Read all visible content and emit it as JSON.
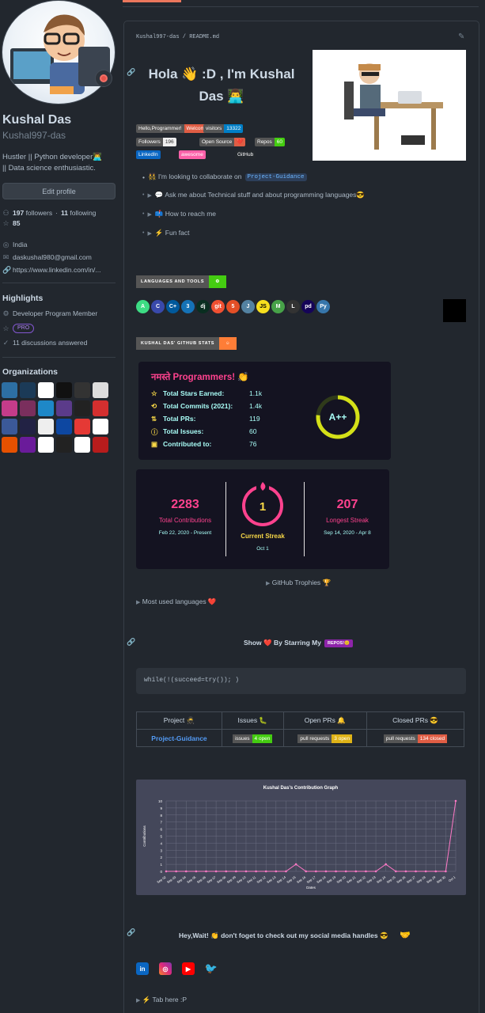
{
  "profile": {
    "name": "Kushal Das",
    "login": "Kushal997-das",
    "bio_line1": "Hustler || Python developer👨‍💻",
    "bio_line2": "|| Data science enthusiastic.",
    "edit_label": "Edit profile",
    "followers_count": "197",
    "followers_label": "followers",
    "following_count": "11",
    "following_label": "following",
    "stars": "85",
    "location": "India",
    "email": "daskushal980@gmail.com",
    "website": "https://www.linkedin.com/in/..."
  },
  "highlights": {
    "title": "Highlights",
    "program": "Developer Program Member",
    "pro": "PRO",
    "discussions": "11 discussions answered"
  },
  "organizations": {
    "title": "Organizations",
    "colors": [
      "#2d6fa3",
      "#1b3a57",
      "#ffffff",
      "#111111",
      "#333333",
      "#dddddd",
      "#c43c8a",
      "#7a2f5d",
      "#1e88c8",
      "#5b3b8a",
      "#222222",
      "#d32f2f",
      "#3b5998",
      "#222244",
      "#eeeeee",
      "#0d47a1",
      "#e53935",
      "#ffffff",
      "#e65100",
      "#6a1b9a",
      "#ffffff",
      "#222222",
      "#ffffff",
      "#b71c1c"
    ]
  },
  "readme": {
    "path": "Kushal997-das / README.md",
    "greeting_line1": "Hola 👋 :D , I'm Kushal",
    "greeting_line2": "Das 👨‍💻",
    "badges": [
      {
        "left": "Hello,Programmer!",
        "right": "Welcome<3",
        "color": "#e05d44"
      },
      {
        "left": "visitors",
        "right": "13322",
        "color": "#007ec6"
      },
      {
        "left": "Followers",
        "right": "196",
        "color": "#eeeeee"
      },
      {
        "left": "Open Source",
        "right": "❤️",
        "color": "#e05d44"
      },
      {
        "left": "Repos",
        "right": "60",
        "color": "#4c1"
      },
      {
        "left": "LinkedIn",
        "right": "",
        "color": "#0a66c2"
      },
      {
        "left": "awesome",
        "right": "",
        "color": "#fc60a8"
      },
      {
        "left": "GitHub",
        "right": "",
        "color": "#24292e"
      }
    ],
    "bullets": {
      "collab_prefix": "👯 I'm looking to collaborate on",
      "collab_project": "Project-Guidance",
      "ask": "💬 Ask me about Technical stuff and about programming languages😎",
      "reach": "📫 How to reach me",
      "fun": "⚡ Fun fact"
    },
    "languages_strip": "LANGUAGES AND TOOLS",
    "techs": [
      {
        "label": "A",
        "color": "#3ddc84"
      },
      {
        "label": "C",
        "color": "#3949ab"
      },
      {
        "label": "C+",
        "color": "#00599c"
      },
      {
        "label": "3",
        "color": "#1572b6"
      },
      {
        "label": "dj",
        "color": "#092e20"
      },
      {
        "label": "git",
        "color": "#f05032"
      },
      {
        "label": "5",
        "color": "#e34f26"
      },
      {
        "label": "J",
        "color": "#5382a1"
      },
      {
        "label": "JS",
        "color": "#f7df1e"
      },
      {
        "label": "M",
        "color": "#47a248"
      },
      {
        "label": "L",
        "color": "#333333"
      },
      {
        "label": "pd",
        "color": "#150458"
      },
      {
        "label": "Py",
        "color": "#3776ab"
      }
    ],
    "stats_strip": "KUSHAL DAS' GITHUB STATS",
    "stats": {
      "title": "नमस्ते Programmers! 👏",
      "rows": [
        {
          "label": "Total Stars Earned:",
          "value": "1.1k"
        },
        {
          "label": "Total Commits (2021):",
          "value": "1.4k"
        },
        {
          "label": "Total PRs:",
          "value": "119"
        },
        {
          "label": "Total Issues:",
          "value": "60"
        },
        {
          "label": "Contributed to:",
          "value": "76"
        }
      ],
      "grade": "A++"
    },
    "streak": {
      "total_value": "2283",
      "total_label": "Total Contributions",
      "total_range": "Feb 22, 2020 - Present",
      "current_value": "1",
      "current_label": "Current Streak",
      "current_range": "Oct 1",
      "longest_value": "207",
      "longest_label": "Longest Streak",
      "longest_range": "Sep 14, 2020 - Apr 8"
    },
    "trophies": "GitHub Trophies 🏆",
    "most_used": "Most used languages ❤️",
    "star_line": "Show ❤️ By Starring My",
    "repos_badge": "REPOS!😊",
    "code": "while(!(succeed=try()); )",
    "table": {
      "headers": [
        "Project 🥷",
        "Issues 🐛",
        "Open PRs 🔔",
        "Closed PRs 😎"
      ],
      "project": "Project-Guidance",
      "issues_left": "issues",
      "issues_right": "4 open",
      "open_left": "pull requests",
      "open_right": "3 open",
      "closed_left": "pull requests",
      "closed_right": "134 closed"
    },
    "social_line": "Hey,Wait! 👏 don't foget to check out my social media handles 😎",
    "tab_here": "⚡ Tab here :P"
  },
  "chart_data": {
    "type": "line",
    "title": "Kushal Das's Contribution Graph",
    "xlabel": "Dates",
    "ylabel": "Contributions",
    "ylim": [
      0,
      10
    ],
    "yticks": [
      0,
      1,
      2,
      3,
      4,
      5,
      6,
      7,
      8,
      9,
      10
    ],
    "x": [
      "Sep 02",
      "Sep 03",
      "Sep 04",
      "Sep 05",
      "Sep 06",
      "Sep 07",
      "Sep 08",
      "Sep 09",
      "Sep 10",
      "Sep 11",
      "Sep 12",
      "Sep 13",
      "Sep 14",
      "Sep 15",
      "Sep 16",
      "Sep 17",
      "Sep 18",
      "Sep 19",
      "Sep 20",
      "Sep 21",
      "Sep 22",
      "Sep 23",
      "Sep 24",
      "Sep 25",
      "Sep 26",
      "Sep 27",
      "Sep 28",
      "Sep 29",
      "Sep 30",
      "Oct 1"
    ],
    "values": [
      0,
      0,
      0,
      0,
      0,
      0,
      0,
      0,
      0,
      0,
      0,
      0,
      0,
      1,
      0,
      0,
      0,
      0,
      0,
      0,
      0,
      0,
      1,
      0,
      0,
      0,
      0,
      0,
      0,
      10
    ],
    "line_color": "#ff79c6",
    "grid": true
  }
}
